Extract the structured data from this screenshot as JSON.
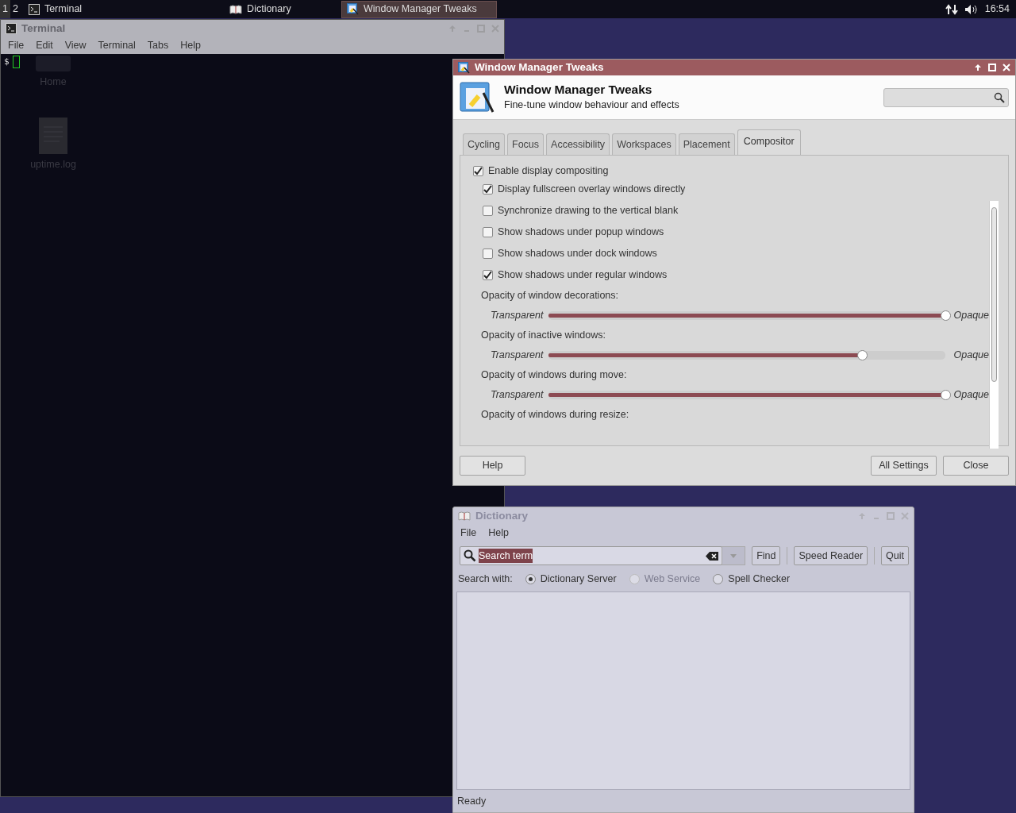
{
  "panel": {
    "workspaces": [
      {
        "label": "1",
        "selected": true
      },
      {
        "label": "2",
        "selected": false
      }
    ],
    "tasks": [
      {
        "label": "Terminal",
        "selected": false
      },
      {
        "label": "Dictionary",
        "selected": false
      },
      {
        "label": "Window Manager Tweaks",
        "selected": true
      }
    ],
    "clock": "16:54"
  },
  "desktop_icons": [
    {
      "label": "Home"
    },
    {
      "label": "uptime.log"
    }
  ],
  "terminal": {
    "title": "Terminal",
    "menu": [
      "File",
      "Edit",
      "View",
      "Terminal",
      "Tabs",
      "Help"
    ],
    "prompt": "$"
  },
  "tweaks": {
    "title": "Window Manager Tweaks",
    "heading": "Window Manager Tweaks",
    "subtitle": "Fine-tune window behaviour and effects",
    "tabs": [
      {
        "label": "Cycling",
        "selected": false
      },
      {
        "label": "Focus",
        "selected": false
      },
      {
        "label": "Accessibility",
        "selected": false
      },
      {
        "label": "Workspaces",
        "selected": false
      },
      {
        "label": "Placement",
        "selected": false
      },
      {
        "label": "Compositor",
        "selected": true
      }
    ],
    "master": {
      "label": "Enable display compositing",
      "checked": true
    },
    "options": [
      {
        "kind": "checkbox",
        "label": "Display fullscreen overlay windows directly",
        "checked": true
      },
      {
        "kind": "checkbox",
        "label": "Synchronize drawing to the vertical blank",
        "checked": false
      },
      {
        "kind": "checkbox",
        "label": "Show shadows under popup windows",
        "checked": false
      },
      {
        "kind": "checkbox",
        "label": "Show shadows under dock windows",
        "checked": false
      },
      {
        "kind": "checkbox",
        "label": "Show shadows under regular windows",
        "checked": true
      },
      {
        "kind": "caption",
        "label": "Opacity of window decorations:"
      },
      {
        "kind": "slider",
        "low": "Transparent",
        "high": "Opaque",
        "level": 1
      },
      {
        "kind": "caption",
        "label": "Opacity of inactive windows:"
      },
      {
        "kind": "slider",
        "low": "Transparent",
        "high": "Opaque",
        "level": 0.79
      },
      {
        "kind": "caption",
        "label": "Opacity of windows during move:"
      },
      {
        "kind": "slider",
        "low": "Transparent",
        "high": "Opaque",
        "level": 1
      },
      {
        "kind": "caption",
        "label": "Opacity of windows during resize:"
      }
    ],
    "buttons_left": [
      "Help"
    ],
    "buttons_right": [
      "All Settings",
      "Close"
    ]
  },
  "dictionary": {
    "title": "Dictionary",
    "menu": [
      "File",
      "Help"
    ],
    "search_value": "Search term",
    "find": "Find",
    "speed_reader": "Speed Reader",
    "quit": "Quit",
    "search_with": "Search with:",
    "sources": [
      {
        "label": "Dictionary Server",
        "selected": true,
        "disabled": false
      },
      {
        "label": "Web Service",
        "selected": false,
        "disabled": true
      },
      {
        "label": "Spell Checker",
        "selected": false,
        "disabled": false
      }
    ],
    "status": "Ready"
  }
}
